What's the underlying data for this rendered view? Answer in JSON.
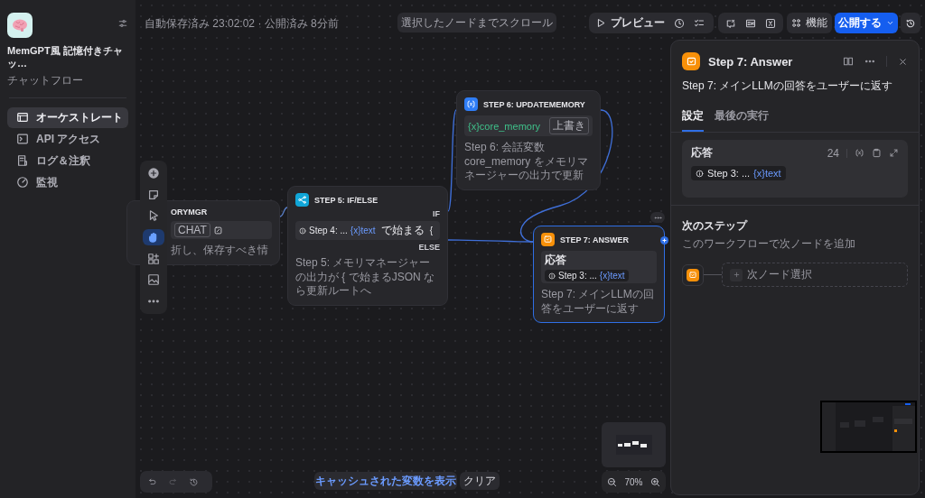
{
  "sidebar": {
    "app_title": "MemGPT風 記憶付きチャッ…",
    "app_type": "チャットフロー",
    "items": [
      {
        "label": "オーケストレート",
        "kind": "orchestrate",
        "selected": true
      },
      {
        "label": "API アクセス",
        "kind": "api",
        "selected": false
      },
      {
        "label": "ログ＆注釈",
        "kind": "logs",
        "selected": false
      },
      {
        "label": "監視",
        "kind": "monitor",
        "selected": false
      }
    ]
  },
  "topbar": {
    "status": "自動保存済み 23:02:02 · 公開済み 8分前",
    "scroll_button": "選択したノードまでスクロール",
    "preview_button": "プレビュー",
    "features_button": "機能",
    "publish_button": "公開する"
  },
  "tools": [
    {
      "kind": "add",
      "selected": false
    },
    {
      "kind": "note",
      "selected": false
    },
    {
      "kind": "pointer",
      "selected": false
    },
    {
      "kind": "hand",
      "selected": true
    },
    {
      "kind": "organize",
      "selected": false
    },
    {
      "kind": "image",
      "selected": false
    },
    {
      "kind": "more",
      "selected": false
    }
  ],
  "nodes": [
    {
      "kind": "partial",
      "title": "ORYMGR",
      "tag": "CHAT",
      "description": "折し、保存すべき情",
      "selected": false
    },
    {
      "kind": "ifelse",
      "title": "STEP 5: IF/ELSE",
      "if_label": "IF",
      "var_node": "Step 4: ...",
      "var_name": "{x}text",
      "operator": "で始まる",
      "value": "{",
      "else_label": "ELSE",
      "description": "Step 5: メモリマネージャーの出力が { で始まるJSON なら更新ルートへ",
      "selected": false
    },
    {
      "kind": "assign",
      "title": "STEP 6: UPDATEMEMORY",
      "variable": "{x}core_memory",
      "mode": "上書き",
      "description": "Step 6: 会話変数 core_memory をメモリマネージャーの出力で更新",
      "selected": false
    },
    {
      "kind": "answer",
      "title": "STEP 7: ANSWER",
      "field_label": "応答",
      "var_node": "Step 3: ...",
      "var_name": "{x}text",
      "description": "Step 7: メインLLMの回答をユーザーに返す",
      "selected": true
    }
  ],
  "bottom": {
    "cache_button": "キャッシュされた変数を表示",
    "clear_button": "クリア",
    "zoom": "70%"
  },
  "panel": {
    "title": "Step 7: Answer",
    "description": "Step 7: メインLLMの回答をユーザーに返す",
    "tabs": [
      {
        "label": "設定",
        "selected": true
      },
      {
        "label": "最後の実行",
        "selected": false
      }
    ],
    "field": {
      "label": "応答",
      "count": "24",
      "var_node": "Step 3: ...",
      "var_name": "{x}text"
    },
    "next_title": "次のステップ",
    "next_hint": "このワークフローで次ノードを追加",
    "next_placeholder": "次ノード選択"
  }
}
